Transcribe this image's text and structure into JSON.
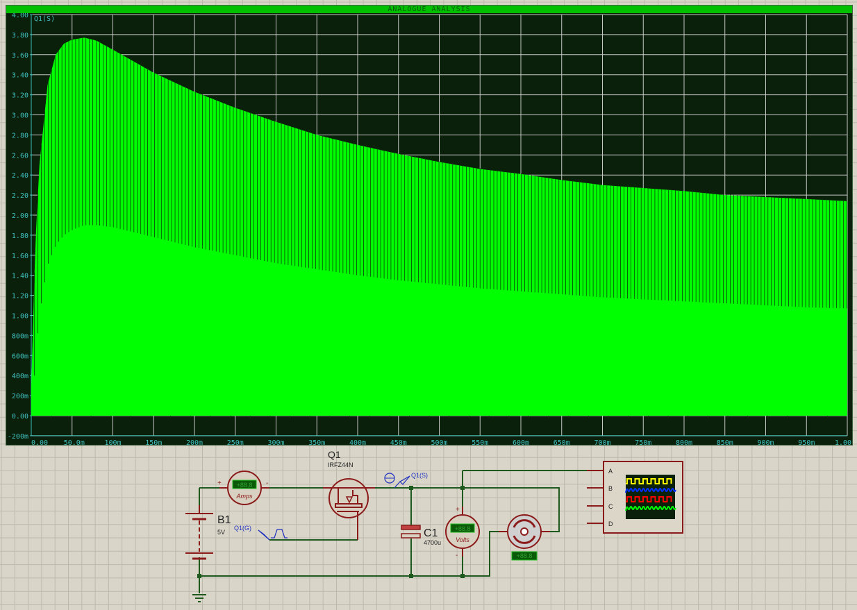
{
  "graph": {
    "title": "ANALOGUE ANALYSIS",
    "trace_label": "Q1(S)",
    "colors": {
      "background": "#0a200a",
      "trace": "#00ff00",
      "grid": "#c8c8c8",
      "axis_text": "#40c0c0",
      "title_bar": "#00c000"
    }
  },
  "chart_data": {
    "type": "area",
    "title": "ANALOGUE ANALYSIS",
    "series": [
      {
        "name": "Q1(S)",
        "x": [
          0,
          0.005,
          0.01,
          0.02,
          0.03,
          0.04,
          0.05,
          0.065,
          0.08,
          0.1,
          0.15,
          0.2,
          0.25,
          0.3,
          0.35,
          0.4,
          0.45,
          0.5,
          0.55,
          0.6,
          0.65,
          0.7,
          0.75,
          0.8,
          0.85,
          0.9,
          0.95,
          1.0
        ],
        "upper": [
          0.3,
          1.7,
          2.5,
          3.3,
          3.6,
          3.71,
          3.75,
          3.77,
          3.74,
          3.65,
          3.42,
          3.23,
          3.07,
          2.93,
          2.8,
          2.7,
          2.61,
          2.53,
          2.46,
          2.41,
          2.35,
          2.3,
          2.27,
          2.24,
          2.2,
          2.18,
          2.16,
          2.14
        ],
        "lower": [
          0.0,
          0.5,
          1.0,
          1.5,
          1.7,
          1.8,
          1.85,
          1.9,
          1.9,
          1.88,
          1.78,
          1.68,
          1.6,
          1.52,
          1.46,
          1.4,
          1.35,
          1.31,
          1.27,
          1.24,
          1.21,
          1.18,
          1.16,
          1.14,
          1.12,
          1.1,
          1.08,
          1.07
        ]
      }
    ],
    "xlim": [
      0,
      1.0
    ],
    "ylim": [
      -0.2,
      4.0
    ],
    "x_ticks": [
      "0.00",
      "50.0m",
      "100m",
      "150m",
      "200m",
      "250m",
      "300m",
      "350m",
      "400m",
      "450m",
      "500m",
      "550m",
      "600m",
      "650m",
      "700m",
      "750m",
      "800m",
      "850m",
      "900m",
      "950m",
      "1.00"
    ],
    "y_ticks": [
      "4.00",
      "3.80",
      "3.60",
      "3.40",
      "3.20",
      "3.00",
      "2.80",
      "2.60",
      "2.40",
      "2.20",
      "2.00",
      "1.80",
      "1.60",
      "1.40",
      "1.20",
      "1.00",
      "800m",
      "600m",
      "400m",
      "200m",
      "0.00",
      "-200m"
    ],
    "grid": true
  },
  "schematic": {
    "battery": {
      "ref": "B1",
      "value": "5V"
    },
    "mosfet": {
      "ref": "Q1",
      "value": "IRFZ44N"
    },
    "capacitor": {
      "ref": "C1",
      "value": "4700u"
    },
    "ammeter": {
      "unit": "Amps",
      "display": "+88.8",
      "plus": "+",
      "minus": "-"
    },
    "voltmeter": {
      "unit": "Volts",
      "display": "+88.8",
      "plus": "+",
      "minus": "-"
    },
    "motor": {
      "display": "+88.8"
    },
    "probe_source": "Q1(S)",
    "generator_gate": "Q1(G)",
    "oscilloscope": {
      "channels": [
        "A",
        "B",
        "C",
        "D"
      ],
      "trace_colors": [
        "#ffff00",
        "#0030ff",
        "#ff0000",
        "#00ff00"
      ]
    },
    "colors": {
      "wire": "#1e5a1e",
      "component": "#8b1a1a",
      "component_fill": "#d8d0c0",
      "probe": "#2030c0"
    }
  }
}
